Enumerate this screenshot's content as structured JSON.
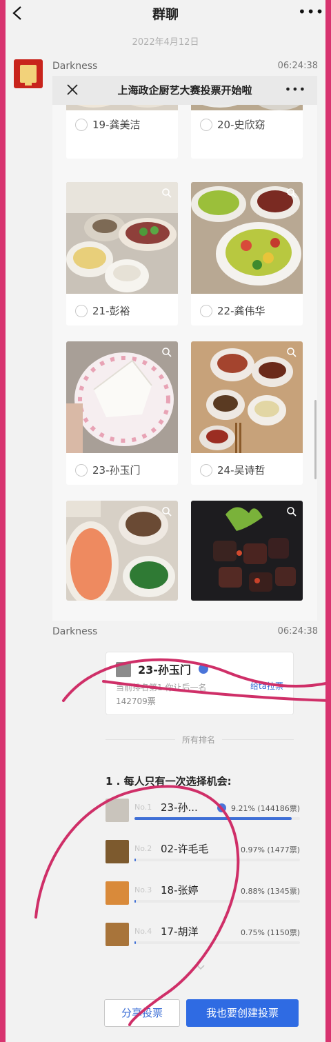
{
  "header": {
    "title": "群聊"
  },
  "date_separator": "2022年4月12日",
  "message1": {
    "sender": "Darkness",
    "time": "06:24:38",
    "card_title": "上海政企厨艺大赛投票开始啦",
    "candidates": [
      {
        "label": "19-龚美洁"
      },
      {
        "label": "20-史欣窈"
      },
      {
        "label": "21-彭裕"
      },
      {
        "label": "22-龚伟华"
      },
      {
        "label": "23-孙玉门"
      },
      {
        "label": "24-吴诗哲"
      }
    ]
  },
  "message2": {
    "sender": "Darkness",
    "time": "06:24:38",
    "vote_card": {
      "name": "23-孙玉门",
      "rank_line": "当前排名第1 你让后一名",
      "action": "给ta拉票",
      "votes": "142709票"
    },
    "all_rank_label": "所有排名",
    "question": "1 . 每人只有一次选择机会:",
    "ranking": [
      {
        "no": "No.1",
        "name": "23-孙...",
        "pct": "9.21% (144186票)",
        "share": 0.95
      },
      {
        "no": "No.2",
        "name": "02-许毛毛",
        "pct": "0.97% (1477票)",
        "share": 0.01
      },
      {
        "no": "No.3",
        "name": "18-张婷",
        "pct": "0.88% (1345票)",
        "share": 0.009
      },
      {
        "no": "No.4",
        "name": "17-胡洋",
        "pct": "0.75% (1150票)",
        "share": 0.008
      }
    ]
  },
  "buttons": {
    "share": "分享投票",
    "create": "我也要创建投票"
  },
  "colors": {
    "accent": "#2f6be3",
    "annotation": "#d8336f"
  }
}
